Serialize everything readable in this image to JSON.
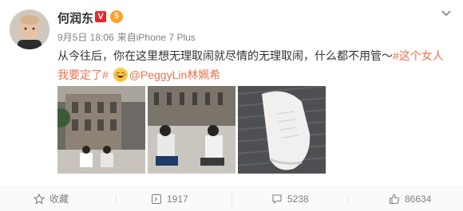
{
  "post": {
    "author": "何润东",
    "vip_badge": "V",
    "level_badge": "5",
    "date": "9月5日 18:06",
    "source_prefix": "来自",
    "source": "iPhone 7 Plus",
    "text_main": "从今往后，你在这里想无理取闹就尽情的无理取闹，什么都不用管～",
    "hashtag": "#这个女人我要定了#",
    "mention": "@PeggyLin林姵希"
  },
  "actions": {
    "favorite": "收藏",
    "repost": "1917",
    "comment": "5238",
    "like": "86634"
  },
  "colors": {
    "link": "#eb7350",
    "meta": "#808080",
    "vip": "#e1282a"
  },
  "icons": [
    "chevron-down-icon",
    "star-icon",
    "repost-icon",
    "comment-icon",
    "thumbs-up-icon",
    "laugh-emoji-icon"
  ]
}
